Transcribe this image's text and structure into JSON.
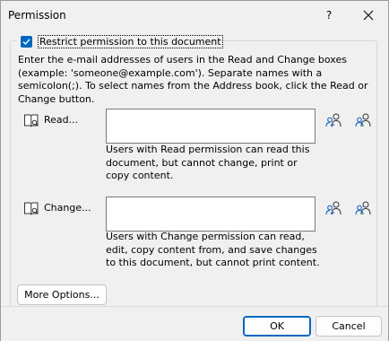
{
  "dialog": {
    "title": "Permission",
    "help_label": "?"
  },
  "restrict": {
    "checked": true,
    "label": "Restrict permission to this document"
  },
  "instructions": "Enter the e-mail addresses of users in the Read and Change boxes (example: 'someone@example.com'). Separate names with a semicolon(;). To select names from the Address book, click the Read or Change button.",
  "read": {
    "button_label": "Read...",
    "value": "",
    "description": "Users with Read permission can read this document, but cannot change, print or copy content."
  },
  "change": {
    "button_label": "Change...",
    "value": "",
    "description": "Users with Change permission can read, edit, copy content from, and save changes to this document, but cannot print content."
  },
  "buttons": {
    "more_options": "More Options...",
    "ok": "OK",
    "cancel": "Cancel"
  },
  "colors": {
    "accent": "#0067c0"
  }
}
